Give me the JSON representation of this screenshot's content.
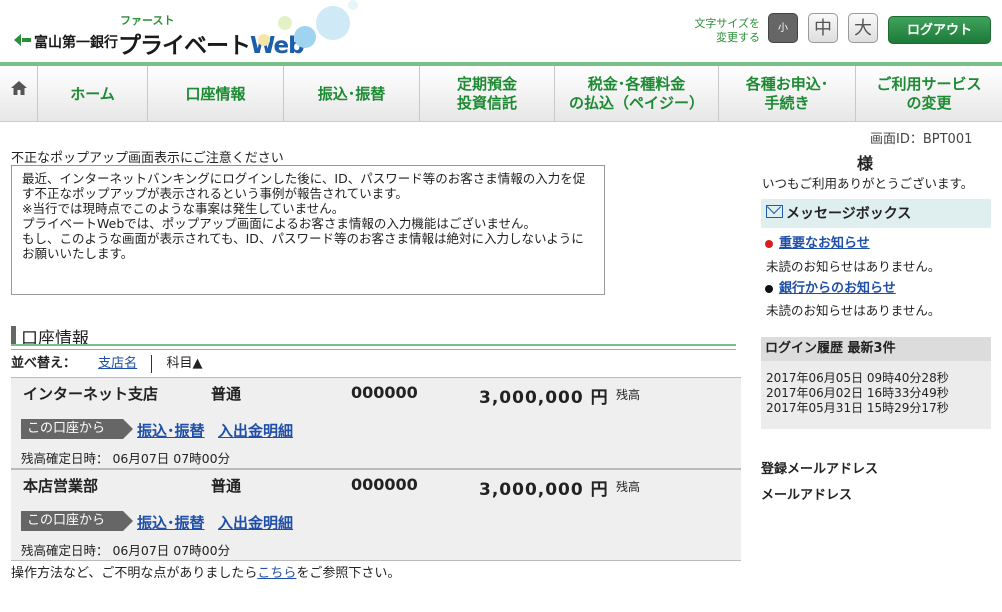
{
  "header": {
    "bank_name": "富山第一銀行",
    "web_sub": "ファースト",
    "web_title_prefix": "プライベート",
    "web_title_suffix": "Web",
    "font_size_label_1": "文字サイズを",
    "font_size_label_2": "変更する",
    "font_small": "小",
    "font_mid": "中",
    "font_large": "大",
    "logout": "ログアウト"
  },
  "nav": {
    "items": [
      {
        "label": "ホーム"
      },
      {
        "label": "口座情報"
      },
      {
        "label": "振込･振替"
      },
      {
        "label1": "定期預金",
        "label2": "投資信託"
      },
      {
        "label1": "税金･各種料金",
        "label2": "の払込（ペイジー）"
      },
      {
        "label1": "各種お申込･",
        "label2": "手続き"
      },
      {
        "label1": "ご利用サービス",
        "label2": "の変更"
      }
    ]
  },
  "screen_id": "画面ID：BPT001",
  "notice": {
    "title": "不正なポップアップ画面表示にご注意ください",
    "lines": [
      "最近、インターネットバンキングにログインした後に、ID、パスワード等のお客さま情報の入力を促す不正なポップアップが表示されるという事例が報告されています。",
      "※当行では現時点でこのような事案は発生していません。",
      "プライベートWebでは、ポップアップ画面によるお客さま情報の入力機能はございません。",
      "もし、このような画面が表示されても、ID、パスワード等のお客さま情報は絶対に入力しないようにお願いいたします。"
    ]
  },
  "accounts_section": {
    "title": "口座情報",
    "sort_label": "並べ替え：",
    "sort_branch": "支店名",
    "sort_subject": "科目▲"
  },
  "accounts": [
    {
      "branch": "インターネット支店",
      "type": "普通",
      "number": "000000",
      "amount": "3,000,000 円",
      "zan": "残高",
      "from": "この口座から",
      "link1": "振込･振替",
      "link2": "入出金明細",
      "confirmed": "残高確定日時： 06月07日 07時00分"
    },
    {
      "branch": "本店営業部",
      "type": "普通",
      "number": "000000",
      "amount": "3,000,000 円",
      "zan": "残高",
      "from": "この口座から",
      "link1": "振込･振替",
      "link2": "入出金明細",
      "confirmed": "残高確定日時： 06月07日 07時00分"
    }
  ],
  "footer": {
    "prefix": "操作方法など、ご不明な点がありましたら",
    "link": "こちら",
    "suffix": "をご参照下さい。"
  },
  "sidebar": {
    "name_suffix": "様",
    "thanks": "いつもご利用ありがとうございます。",
    "message_box_title": "メッセージボックス",
    "important_title": "重要なお知らせ",
    "important_status": "未読のお知らせはありません。",
    "bank_title": "銀行からのお知らせ",
    "bank_status": "未読のお知らせはありません。",
    "history_title": "ログイン履歴 最新3件",
    "history": [
      "2017年06月05日 09時40分28秒",
      "2017年06月02日 16時33分49秒",
      "2017年05月31日 15時29分17秒"
    ],
    "email_label": "登録メールアドレス",
    "email_value": "メールアドレス"
  },
  "colors": {
    "accent_green": "#1e8a33",
    "logout_green": "#2e8f47",
    "important_dot": "#d81e1e"
  }
}
